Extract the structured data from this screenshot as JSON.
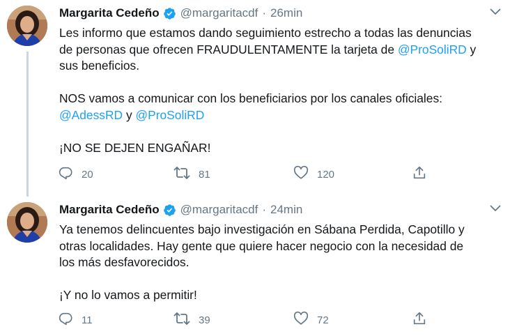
{
  "tweets": [
    {
      "author": {
        "name": "Margarita Cedeño",
        "handle": "@margaritacdf"
      },
      "separator": "·",
      "time": "26min",
      "text": {
        "line1": "Les informo que estamos dando seguimiento estrecho a todas las denuncias",
        "line2_pre": "de personas que ofrecen FRAUDULENTAMENTE la tarjeta de ",
        "line2_mention": "@ProSoliRD",
        "line2_post": " y",
        "line3": "sus beneficios.",
        "line4": "NOS vamos a comunicar con los beneficiarios por los canales oficiales:",
        "line5_mention1": "@AdessRD",
        "line5_mid": " y ",
        "line5_mention2": "@ProSoliRD",
        "line6": "¡NO SE DEJEN ENGAÑAR!"
      },
      "stats": {
        "replies": "20",
        "retweets": "81",
        "likes": "120"
      }
    },
    {
      "author": {
        "name": "Margarita Cedeño",
        "handle": "@margaritacdf"
      },
      "separator": "·",
      "time": "24min",
      "text": {
        "line1": "Ya tenemos delincuentes bajo investigación en Sábana Perdida, Capotillo y",
        "line2": "otras localidades. Hay gente que quiere hacer negocio con la necesidad de",
        "line3": "los más desfavorecidos.",
        "line4": "¡Y no lo vamos a permitir!"
      },
      "stats": {
        "replies": "11",
        "retweets": "39",
        "likes": "72"
      }
    }
  ],
  "colors": {
    "text": "#14171a",
    "secondary": "#657786",
    "link": "#1da1f2",
    "verified": "#1da1f2",
    "thread_line": "#ccd6dd"
  },
  "icons": [
    "verified-badge-icon",
    "chevron-down-icon",
    "reply-icon",
    "retweet-icon",
    "like-icon",
    "share-icon"
  ]
}
